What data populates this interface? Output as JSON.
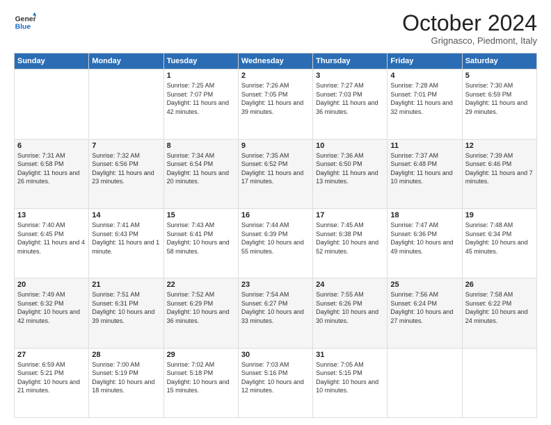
{
  "header": {
    "logo_general": "General",
    "logo_blue": "Blue",
    "month_title": "October 2024",
    "location": "Grignasco, Piedmont, Italy"
  },
  "weekdays": [
    "Sunday",
    "Monday",
    "Tuesday",
    "Wednesday",
    "Thursday",
    "Friday",
    "Saturday"
  ],
  "weeks": [
    [
      {
        "day": "",
        "detail": ""
      },
      {
        "day": "",
        "detail": ""
      },
      {
        "day": "1",
        "detail": "Sunrise: 7:25 AM\nSunset: 7:07 PM\nDaylight: 11 hours and 42 minutes."
      },
      {
        "day": "2",
        "detail": "Sunrise: 7:26 AM\nSunset: 7:05 PM\nDaylight: 11 hours and 39 minutes."
      },
      {
        "day": "3",
        "detail": "Sunrise: 7:27 AM\nSunset: 7:03 PM\nDaylight: 11 hours and 36 minutes."
      },
      {
        "day": "4",
        "detail": "Sunrise: 7:28 AM\nSunset: 7:01 PM\nDaylight: 11 hours and 32 minutes."
      },
      {
        "day": "5",
        "detail": "Sunrise: 7:30 AM\nSunset: 6:59 PM\nDaylight: 11 hours and 29 minutes."
      }
    ],
    [
      {
        "day": "6",
        "detail": "Sunrise: 7:31 AM\nSunset: 6:58 PM\nDaylight: 11 hours and 26 minutes."
      },
      {
        "day": "7",
        "detail": "Sunrise: 7:32 AM\nSunset: 6:56 PM\nDaylight: 11 hours and 23 minutes."
      },
      {
        "day": "8",
        "detail": "Sunrise: 7:34 AM\nSunset: 6:54 PM\nDaylight: 11 hours and 20 minutes."
      },
      {
        "day": "9",
        "detail": "Sunrise: 7:35 AM\nSunset: 6:52 PM\nDaylight: 11 hours and 17 minutes."
      },
      {
        "day": "10",
        "detail": "Sunrise: 7:36 AM\nSunset: 6:50 PM\nDaylight: 11 hours and 13 minutes."
      },
      {
        "day": "11",
        "detail": "Sunrise: 7:37 AM\nSunset: 6:48 PM\nDaylight: 11 hours and 10 minutes."
      },
      {
        "day": "12",
        "detail": "Sunrise: 7:39 AM\nSunset: 6:46 PM\nDaylight: 11 hours and 7 minutes."
      }
    ],
    [
      {
        "day": "13",
        "detail": "Sunrise: 7:40 AM\nSunset: 6:45 PM\nDaylight: 11 hours and 4 minutes."
      },
      {
        "day": "14",
        "detail": "Sunrise: 7:41 AM\nSunset: 6:43 PM\nDaylight: 11 hours and 1 minute."
      },
      {
        "day": "15",
        "detail": "Sunrise: 7:43 AM\nSunset: 6:41 PM\nDaylight: 10 hours and 58 minutes."
      },
      {
        "day": "16",
        "detail": "Sunrise: 7:44 AM\nSunset: 6:39 PM\nDaylight: 10 hours and 55 minutes."
      },
      {
        "day": "17",
        "detail": "Sunrise: 7:45 AM\nSunset: 6:38 PM\nDaylight: 10 hours and 52 minutes."
      },
      {
        "day": "18",
        "detail": "Sunrise: 7:47 AM\nSunset: 6:36 PM\nDaylight: 10 hours and 49 minutes."
      },
      {
        "day": "19",
        "detail": "Sunrise: 7:48 AM\nSunset: 6:34 PM\nDaylight: 10 hours and 45 minutes."
      }
    ],
    [
      {
        "day": "20",
        "detail": "Sunrise: 7:49 AM\nSunset: 6:32 PM\nDaylight: 10 hours and 42 minutes."
      },
      {
        "day": "21",
        "detail": "Sunrise: 7:51 AM\nSunset: 6:31 PM\nDaylight: 10 hours and 39 minutes."
      },
      {
        "day": "22",
        "detail": "Sunrise: 7:52 AM\nSunset: 6:29 PM\nDaylight: 10 hours and 36 minutes."
      },
      {
        "day": "23",
        "detail": "Sunrise: 7:54 AM\nSunset: 6:27 PM\nDaylight: 10 hours and 33 minutes."
      },
      {
        "day": "24",
        "detail": "Sunrise: 7:55 AM\nSunset: 6:26 PM\nDaylight: 10 hours and 30 minutes."
      },
      {
        "day": "25",
        "detail": "Sunrise: 7:56 AM\nSunset: 6:24 PM\nDaylight: 10 hours and 27 minutes."
      },
      {
        "day": "26",
        "detail": "Sunrise: 7:58 AM\nSunset: 6:22 PM\nDaylight: 10 hours and 24 minutes."
      }
    ],
    [
      {
        "day": "27",
        "detail": "Sunrise: 6:59 AM\nSunset: 5:21 PM\nDaylight: 10 hours and 21 minutes."
      },
      {
        "day": "28",
        "detail": "Sunrise: 7:00 AM\nSunset: 5:19 PM\nDaylight: 10 hours and 18 minutes."
      },
      {
        "day": "29",
        "detail": "Sunrise: 7:02 AM\nSunset: 5:18 PM\nDaylight: 10 hours and 15 minutes."
      },
      {
        "day": "30",
        "detail": "Sunrise: 7:03 AM\nSunset: 5:16 PM\nDaylight: 10 hours and 12 minutes."
      },
      {
        "day": "31",
        "detail": "Sunrise: 7:05 AM\nSunset: 5:15 PM\nDaylight: 10 hours and 10 minutes."
      },
      {
        "day": "",
        "detail": ""
      },
      {
        "day": "",
        "detail": ""
      }
    ]
  ]
}
